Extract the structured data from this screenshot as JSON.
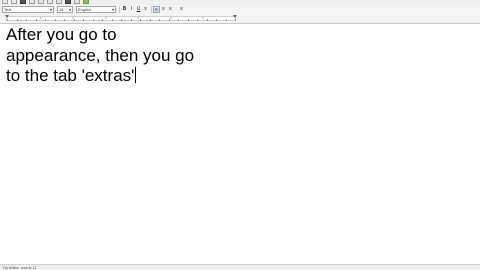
{
  "toolbar": {
    "icons": [
      "new-icon",
      "open-icon",
      "save-icon",
      "print-icon",
      "undo-icon",
      "redo-icon",
      "cut-icon",
      "copy-icon",
      "paste-icon",
      "check-icon"
    ]
  },
  "format_bar": {
    "style_value": "Text",
    "font_value": "Arial",
    "size_value": "18",
    "lang_value": "English",
    "bold_label": "B",
    "italic_label": "I",
    "underline_label": "U",
    "sub_label": "x",
    "align_left_label": "≡",
    "align_center_label": "≡",
    "align_right_label": "≡",
    "align_justify_label": "≡"
  },
  "ruler": {
    "numbers": [
      "1",
      "2",
      "3",
      "4",
      "5",
      "6"
    ]
  },
  "document": {
    "lines": [
      "After you go to",
      "appearance, then you go",
      "to the tab 'extras'"
    ]
  },
  "statusbar": {
    "text": "Txt folder: wordy 11"
  },
  "colors": {
    "background": "#ffffff",
    "toolbar": "#f0f0f0",
    "text": "#000000"
  }
}
